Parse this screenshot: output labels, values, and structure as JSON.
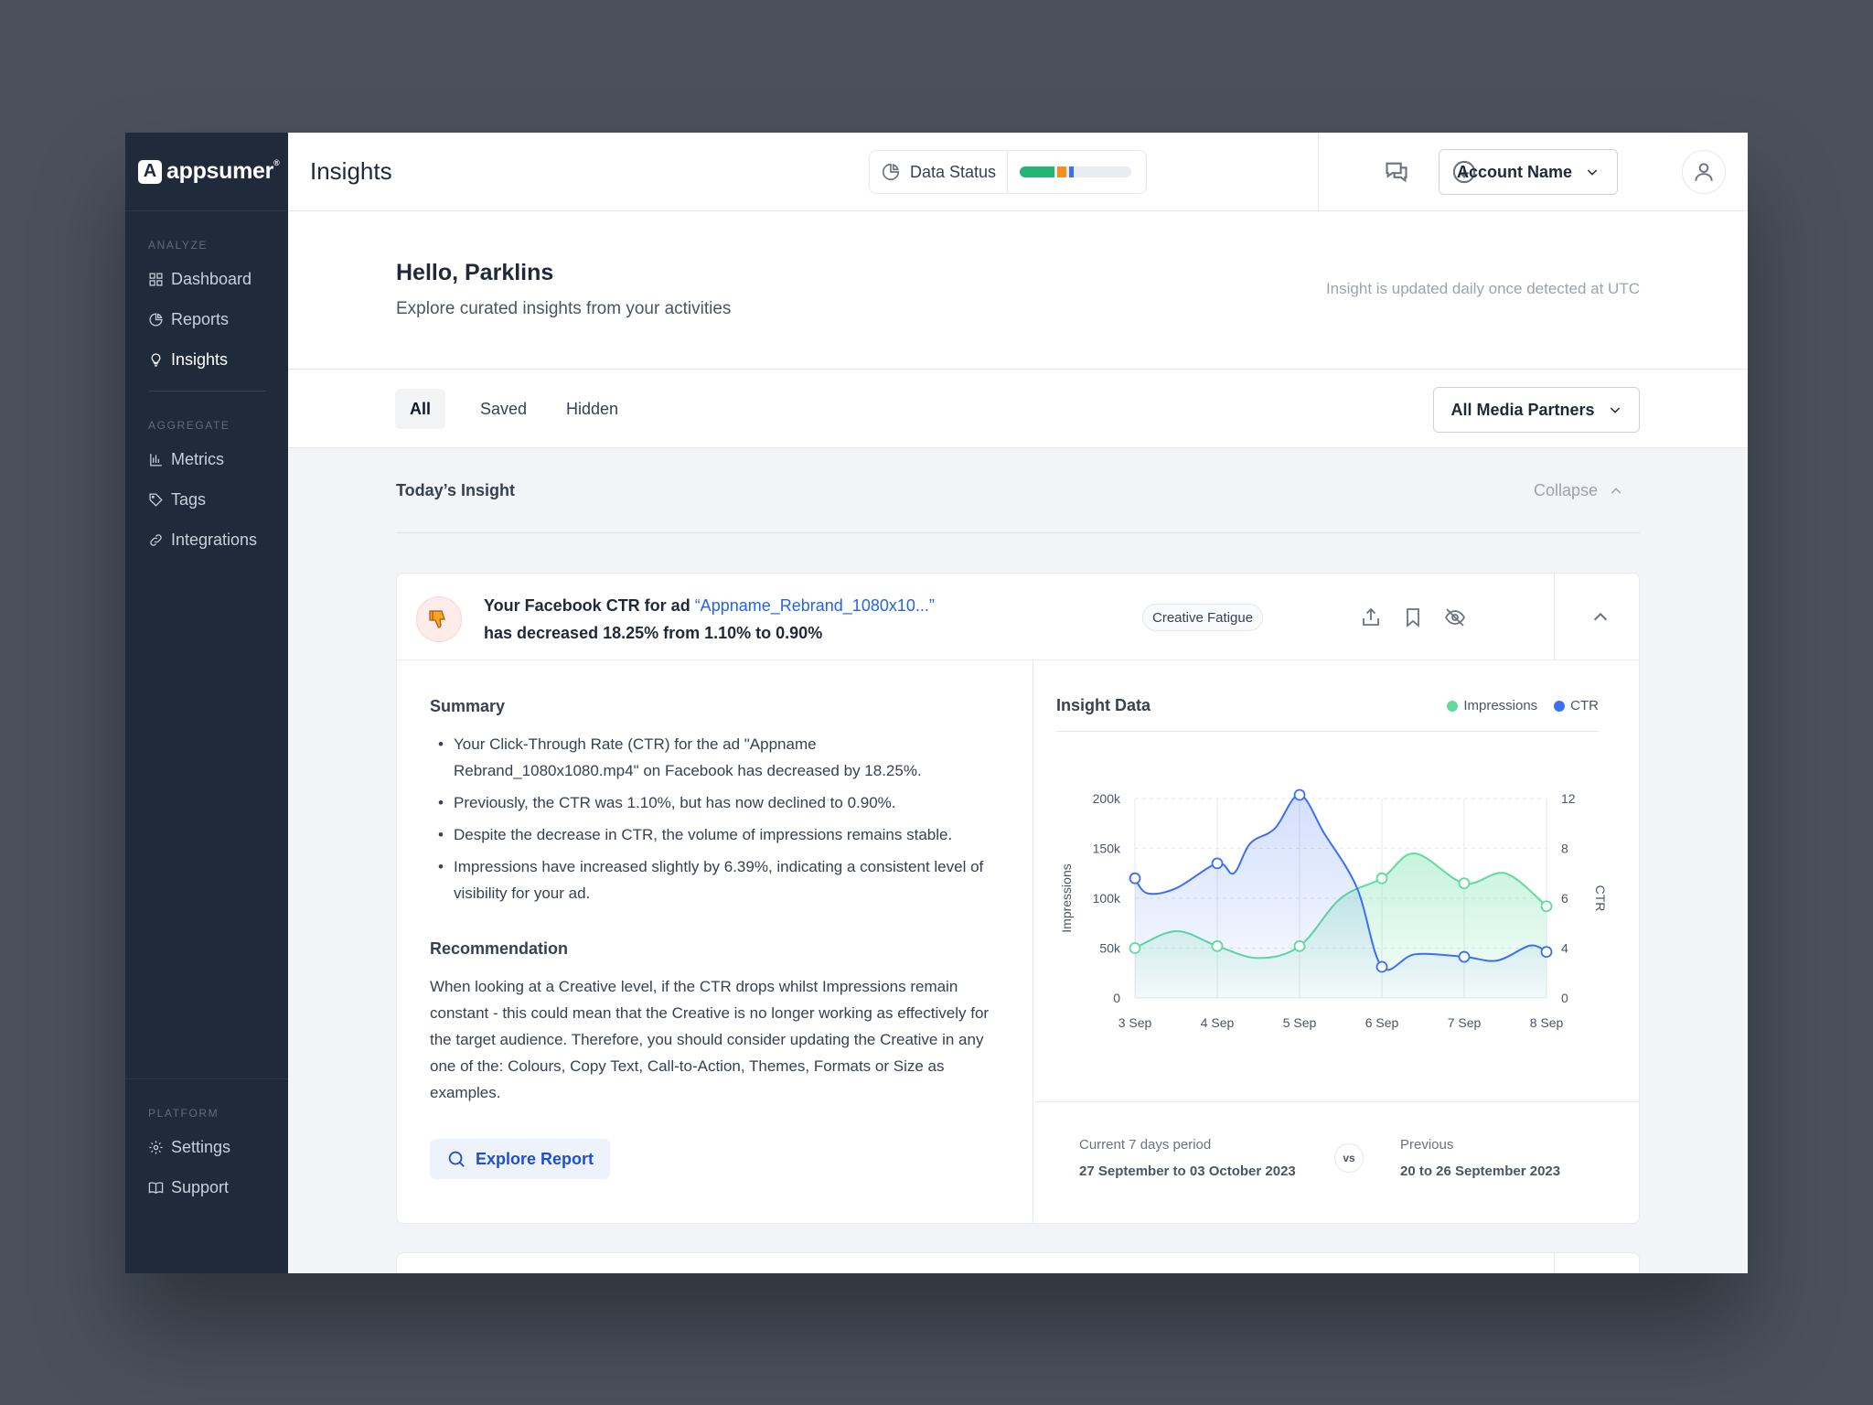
{
  "brand": {
    "mark": "A",
    "name": "appsumer",
    "reg": "®"
  },
  "sidebar": {
    "sections": [
      {
        "heading": "ANALYZE",
        "items": [
          {
            "label": "Dashboard",
            "icon": "grid-icon"
          },
          {
            "label": "Reports",
            "icon": "pie-chart-icon"
          },
          {
            "label": "Insights",
            "icon": "lightbulb-icon",
            "active": true
          }
        ]
      },
      {
        "heading": "AGGREGATE",
        "items": [
          {
            "label": "Metrics",
            "icon": "bar-chart-icon"
          },
          {
            "label": "Tags",
            "icon": "tag-icon"
          },
          {
            "label": "Integrations",
            "icon": "link-icon"
          }
        ]
      }
    ],
    "platform": {
      "heading": "PLATFORM",
      "items": [
        {
          "label": "Settings",
          "icon": "gear-icon"
        },
        {
          "label": "Support",
          "icon": "book-icon"
        }
      ]
    }
  },
  "topbar": {
    "title": "Insights",
    "data_status": {
      "label": "Data Status",
      "segments": [
        {
          "color": "#22b573",
          "fraction": 0.31
        },
        {
          "color": "#f5901e",
          "fraction": 0.08
        },
        {
          "color": "#3b6ff5",
          "fraction": 0.04
        }
      ]
    },
    "account_label": "Account Name"
  },
  "greeting": {
    "title": "Hello, Parklins",
    "subtitle": "Explore curated insights from your activities",
    "note": "Insight is updated daily once detected at UTC"
  },
  "tabs": [
    {
      "label": "All",
      "active": true
    },
    {
      "label": "Saved"
    },
    {
      "label": "Hidden"
    }
  ],
  "partners_filter": "All Media Partners",
  "section": {
    "title": "Today’s Insight",
    "collapse_label": "Collapse"
  },
  "insight": {
    "line1_prefix": "Your Facebook CTR for ad ",
    "ad_name": "“Appname_Rebrand_1080x10...”",
    "line2": "has decreased 18.25% from 1.10% to 0.90%",
    "badge": "Creative Fatigue",
    "summary_title": "Summary",
    "summary": [
      "Your Click-Through Rate (CTR) for the ad \"Appname Rebrand_1080x1080.mp4\" on Facebook has decreased by 18.25%.",
      "Previously, the CTR was 1.10%, but has now declined to 0.90%.",
      "Despite the decrease in CTR, the volume of impressions remains stable.",
      "Impressions have increased slightly by 6.39%, indicating a consistent level of visibility for your ad."
    ],
    "recommendation_title": "Recommendation",
    "recommendation": "When looking at a Creative level, if the CTR drops whilst Impressions remain constant - this could mean that the Creative is no longer working as effectively for the target audience. Therefore, you should consider updating the Creative in any one of the: Colours, Copy Text, Call-to-Action, Themes, Formats or Size as examples.",
    "explore_label": "Explore Report",
    "chart_title": "Insight Data",
    "period": {
      "current_label": "Current 7 days period",
      "current_value": "27 September to 03 October 2023",
      "vs": "vs",
      "previous_label": "Previous",
      "previous_value": "20 to 26 September 2023"
    }
  },
  "chart_data": {
    "type": "area",
    "categories": [
      "3 Sep",
      "4 Sep",
      "5 Sep",
      "6 Sep",
      "7 Sep",
      "8 Sep"
    ],
    "ylabel": "Impressions",
    "y2label": "CTR",
    "ylim": [
      0,
      200000
    ],
    "y2lim": [
      0,
      12
    ],
    "yticks": [
      "0",
      "50k",
      "100k",
      "150k",
      "200k"
    ],
    "y2ticks": [
      "0",
      "4",
      "6",
      "8",
      "12"
    ],
    "grid": true,
    "legend": "top-right",
    "series": [
      {
        "name": "Impressions",
        "axis": "left",
        "color": "#5fdc9c",
        "x": [
          0,
          0.5,
          1,
          1.5,
          2,
          2.5,
          3,
          3.4,
          4,
          4.5,
          5
        ],
        "values": [
          50000,
          67000,
          52000,
          40000,
          52000,
          100000,
          120000,
          145000,
          115000,
          125000,
          92000
        ]
      },
      {
        "name": "CTR",
        "axis": "right",
        "color": "#3b6ff5",
        "x": [
          0,
          0.15,
          0.5,
          1,
          1.2,
          1.4,
          1.7,
          2,
          2.3,
          2.7,
          3,
          3.4,
          4,
          4.4,
          4.8,
          5
        ],
        "values": [
          6.8,
          6.2,
          6.4,
          7.4,
          7.0,
          8.4,
          9.6,
          13.3,
          9.2,
          6.4,
          2.5,
          3.5,
          3.3,
          3.0,
          4.1,
          3.7
        ]
      }
    ],
    "markers": {
      "Impressions": [
        0,
        1,
        2,
        3,
        4,
        5
      ],
      "CTR": [
        0,
        1,
        2,
        3,
        4,
        5
      ]
    }
  }
}
